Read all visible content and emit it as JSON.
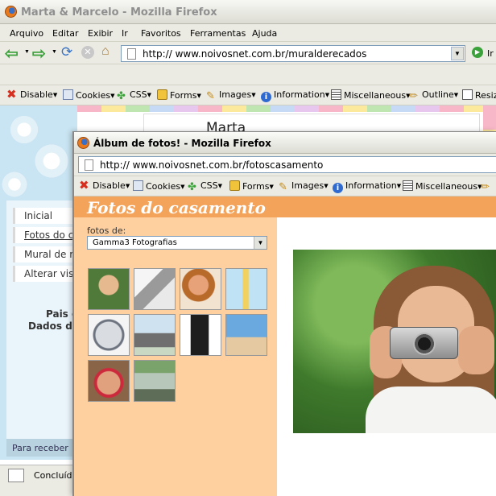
{
  "back_window": {
    "title": "Marta & Marcelo - Mozilla Firefox",
    "menu": [
      "Arquivo",
      "Editar",
      "Exibir",
      "Ir",
      "Favoritos",
      "Ferramentas",
      "Ajuda"
    ],
    "url": "http:// www.noivosnet.com.br/muralderecados",
    "go_label": "Ir",
    "toolbar": [
      "Disable",
      "Cookies",
      "CSS",
      "Forms",
      "Images",
      "Information",
      "Miscellaneous",
      "Outline",
      "Resiz"
    ],
    "page_title_partial": "Marta",
    "sidebar": [
      "Inicial",
      "Fotos do c",
      "Mural de r",
      "Alterar vis"
    ],
    "info_lines": [
      "Pais c",
      "Dados da"
    ],
    "bottom_bar": "Para receber",
    "status": "Concluído"
  },
  "front_window": {
    "title": "Álbum de fotos! - Mozilla Firefox",
    "url": "http:// www.noivosnet.com.br/fotoscasamento",
    "toolbar": [
      "Disable",
      "Cookies",
      "CSS",
      "Forms",
      "Images",
      "Information",
      "Miscellaneous"
    ],
    "heading": "Fotos do casamento",
    "select_label": "fotos de:",
    "select_value": "Gamma3 Fotografias",
    "thumbnails": [
      "woman-camera-thumb",
      "grater-thumb",
      "woman-portrait-thumb",
      "lifeguard-tower-thumb",
      "computer-mouse-thumb",
      "elephant-thumb",
      "speaker-thumb",
      "beach-man-thumb",
      "face-paint-thumb",
      "bus-stop-thumb"
    ]
  },
  "colors": {
    "firefox_chrome": "#ecebe3",
    "album_orange": "#f4a35a",
    "album_panel": "#fed0a0",
    "sidebar_blue": "#c9e4f2"
  }
}
